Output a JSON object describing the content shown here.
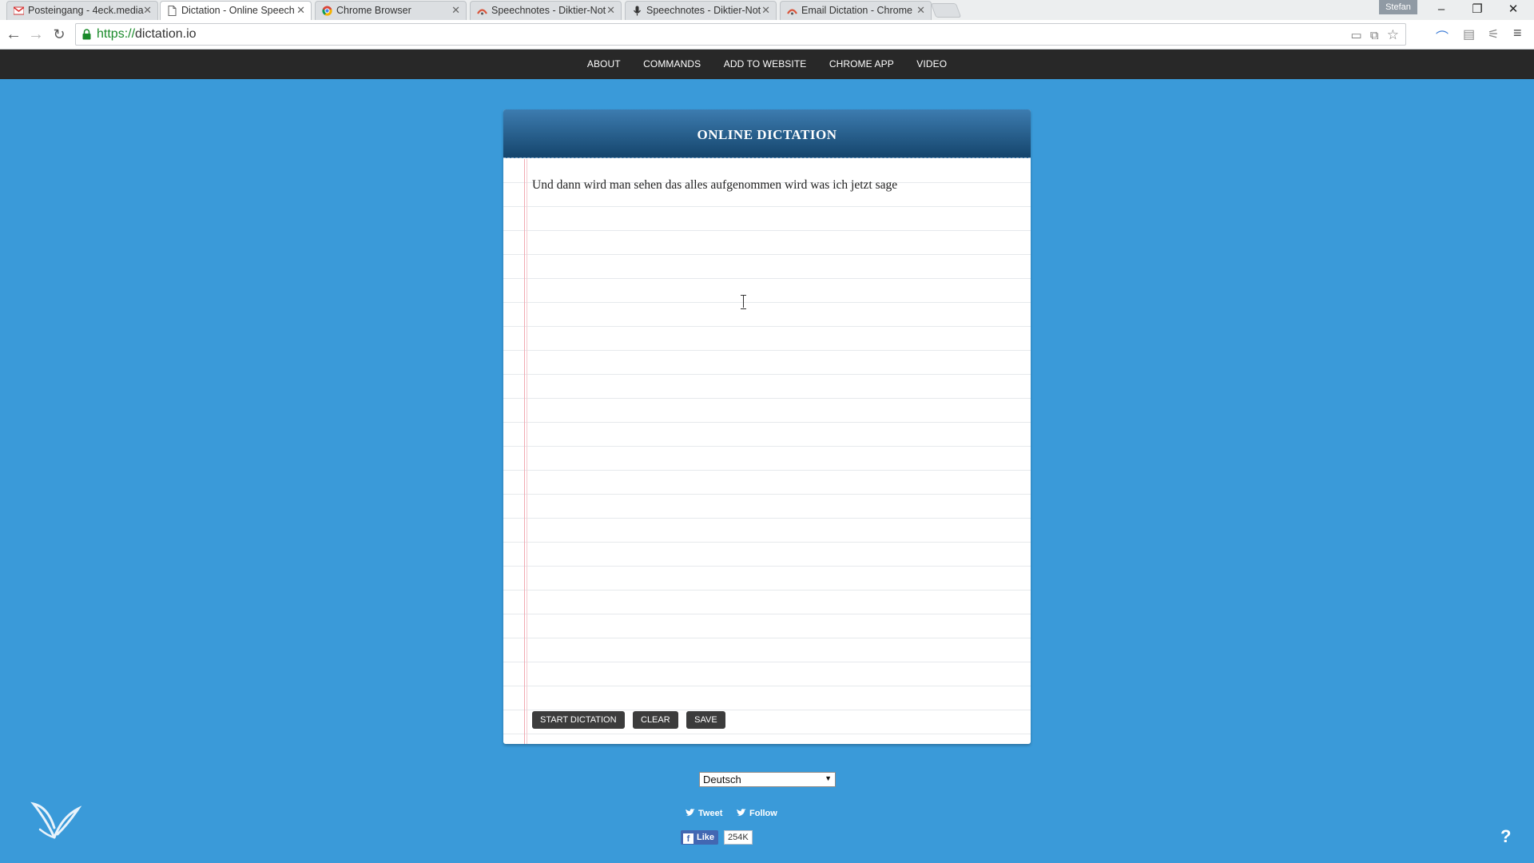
{
  "browser": {
    "tabs": [
      {
        "title": "Posteingang - 4eck.media",
        "icon": "gmail-icon"
      },
      {
        "title": "Dictation - Online Speech",
        "icon": "page-icon",
        "active": true
      },
      {
        "title": "Chrome Browser",
        "icon": "chrome-icon"
      },
      {
        "title": "Speechnotes - Diktier-Not",
        "icon": "speechnotes-icon"
      },
      {
        "title": "Speechnotes - Diktier-Not",
        "icon": "microphone-icon"
      },
      {
        "title": "Email Dictation - Chrome",
        "icon": "speechnotes-icon"
      }
    ],
    "profile_name": "Stefan",
    "url_scheme": "https://",
    "url_host": "dictation.io"
  },
  "nav": {
    "items": [
      "ABOUT",
      "COMMANDS",
      "ADD TO WEBSITE",
      "CHROME APP",
      "VIDEO"
    ]
  },
  "pad": {
    "title": "ONLINE DICTATION",
    "text": "Und dann wird man sehen das alles aufgenommen wird was ich jetzt sage",
    "buttons": {
      "start": "START DICTATION",
      "clear": "CLEAR",
      "save": "SAVE"
    }
  },
  "language": {
    "selected": "Deutsch"
  },
  "social": {
    "tweet": "Tweet",
    "follow": "Follow",
    "like": "Like",
    "like_count": "254K"
  },
  "help": "?",
  "colors": {
    "background": "#3a9ad9",
    "nav": "#282828",
    "header_top": "#3d7cb0",
    "header_bottom": "#15456c",
    "button": "#3c3c3c"
  }
}
